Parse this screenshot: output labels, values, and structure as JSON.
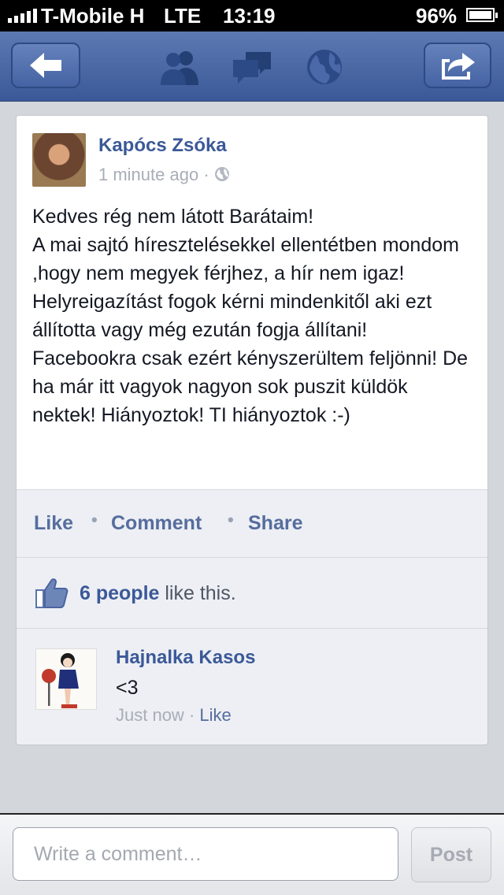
{
  "status_bar": {
    "carrier": "T-Mobile H",
    "network": "LTE",
    "time": "13:19",
    "battery": "96%",
    "battery_level": 0.96
  },
  "nav": {
    "icons": [
      "back-arrow-icon",
      "friends-icon",
      "messages-icon",
      "globe-icon",
      "share-icon"
    ],
    "color": "#3b5998"
  },
  "post": {
    "author": "Kapócs Zsóka",
    "time": "1 minute ago",
    "separator": "·",
    "text": "Kedves rég nem látott Barátaim!\nA mai sajtó híresztelésekkel ellentétben mondom ,hogy nem megyek férjhez, a hír nem igaz! Helyreigazítást fogok kérni mindenkitől aki ezt állította vagy még ezután fogja állítani! Facebookra csak ezért kényszerültem feljönni! De ha már itt vagyok nagyon sok puszit küldök nektek! Hiányoztok! TI hiányoztok :-)"
  },
  "actions": {
    "like": "Like",
    "comment": "Comment",
    "share": "Share",
    "dot": "•"
  },
  "likes": {
    "count": "6 people",
    "suffix": " like this."
  },
  "comment": {
    "author": "Hajnalka Kasos",
    "text": "<3",
    "time": "Just now",
    "separator": " · ",
    "like": "Like"
  },
  "composer": {
    "placeholder": "Write a comment…",
    "post_label": "Post"
  }
}
